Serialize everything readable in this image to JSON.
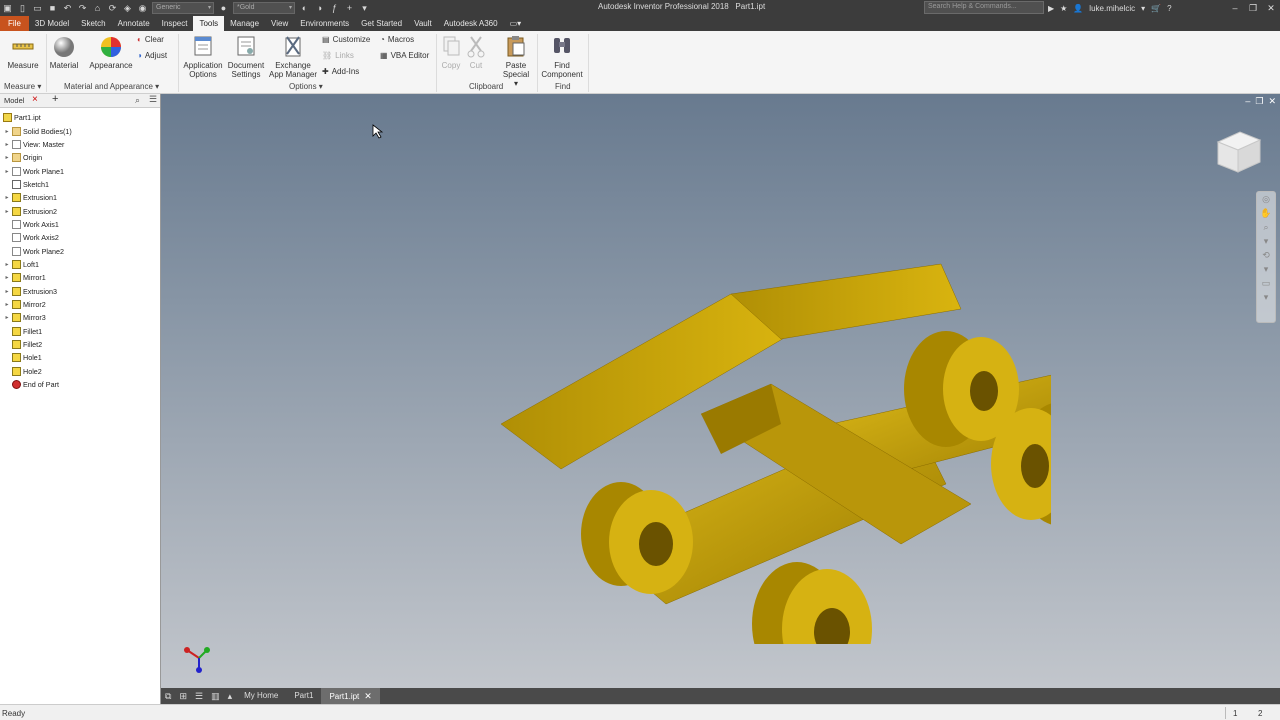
{
  "titlebar": {
    "app_title": "Autodesk Inventor Professional 2018",
    "doc_title": "Part1.ipt",
    "material_combo": "Generic",
    "appearance_combo": "*Gold",
    "search_placeholder": "Search Help & Commands...",
    "user": "luke.mihelcic"
  },
  "menu": {
    "tabs": [
      "File",
      "3D Model",
      "Sketch",
      "Annotate",
      "Inspect",
      "Tools",
      "Manage",
      "View",
      "Environments",
      "Get Started",
      "Vault",
      "Autodesk A360"
    ],
    "active": "Tools"
  },
  "ribbon": {
    "measure": "Measure",
    "measure_group": "Measure",
    "material": "Material",
    "appearance": "Appearance",
    "clear": "Clear",
    "adjust": "Adjust",
    "material_group": "Material and Appearance",
    "app_options_1": "Application",
    "app_options_2": "Options",
    "doc_settings_1": "Document",
    "doc_settings_2": "Settings",
    "exchange_1": "Exchange",
    "exchange_2": "App Manager",
    "customize": "Customize",
    "links": "Links",
    "addins": "Add-Ins",
    "macros": "Macros",
    "vba": "VBA Editor",
    "options_group": "Options",
    "copy": "Copy",
    "cut": "Cut",
    "paste_1": "Paste",
    "paste_2": "Special",
    "clipboard_group": "Clipboard",
    "find_1": "Find",
    "find_2": "Component",
    "find_group": "Find"
  },
  "browser": {
    "tab": "Model",
    "items": [
      {
        "label": "Part1.ipt",
        "icon": "part",
        "exp": ""
      },
      {
        "label": "Solid Bodies(1)",
        "icon": "folder",
        "exp": "▸"
      },
      {
        "label": "View: Master",
        "icon": "plane",
        "exp": "▸"
      },
      {
        "label": "Origin",
        "icon": "folder",
        "exp": "▸"
      },
      {
        "label": "Work Plane1",
        "icon": "plane",
        "exp": "▸"
      },
      {
        "label": "Sketch1",
        "icon": "sketch",
        "exp": ""
      },
      {
        "label": "Extrusion1",
        "icon": "feat",
        "exp": "▸"
      },
      {
        "label": "Extrusion2",
        "icon": "feat",
        "exp": "▸"
      },
      {
        "label": "Work Axis1",
        "icon": "plane",
        "exp": ""
      },
      {
        "label": "Work Axis2",
        "icon": "plane",
        "exp": ""
      },
      {
        "label": "Work Plane2",
        "icon": "plane",
        "exp": ""
      },
      {
        "label": "Loft1",
        "icon": "feat",
        "exp": "▸"
      },
      {
        "label": "Mirror1",
        "icon": "feat",
        "exp": "▸"
      },
      {
        "label": "Extrusion3",
        "icon": "feat",
        "exp": "▸"
      },
      {
        "label": "Mirror2",
        "icon": "feat",
        "exp": "▸"
      },
      {
        "label": "Mirror3",
        "icon": "feat",
        "exp": "▸"
      },
      {
        "label": "Fillet1",
        "icon": "feat",
        "exp": ""
      },
      {
        "label": "Fillet2",
        "icon": "feat",
        "exp": ""
      },
      {
        "label": "Hole1",
        "icon": "feat",
        "exp": ""
      },
      {
        "label": "Hole2",
        "icon": "feat",
        "exp": ""
      },
      {
        "label": "End of Part",
        "icon": "end",
        "exp": ""
      }
    ]
  },
  "doc_tabs": {
    "home": "My Home",
    "part1": "Part1",
    "active": "Part1.ipt"
  },
  "status": {
    "text": "Ready",
    "n1": "1",
    "n2": "2"
  },
  "colors": {
    "accent_file": "#c8531e",
    "model_gold": "#c9a400"
  }
}
